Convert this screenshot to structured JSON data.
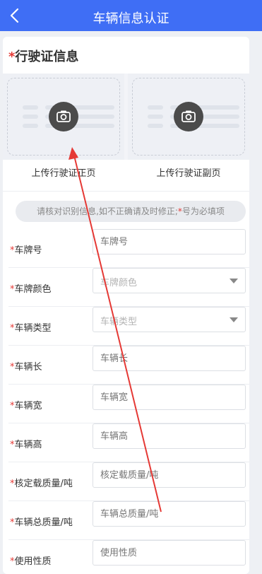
{
  "header": {
    "title": "车辆信息认证",
    "back_icon": "chevron-left-icon"
  },
  "section": {
    "title_required": "*",
    "title": "行驶证信息"
  },
  "photos": [
    {
      "caption": "上传行驶证正页",
      "icon": "camera-icon"
    },
    {
      "caption": "上传行驶证副页",
      "icon": "camera-icon"
    }
  ],
  "notice": {
    "before": "请核对识别信息,如不正确请及时修正;",
    "star": "*",
    "after": "号为必填项"
  },
  "fields": [
    {
      "label": "车牌号",
      "placeholder": "车牌号",
      "type": "input"
    },
    {
      "label": "车牌颜色",
      "placeholder": "车牌颜色",
      "type": "select"
    },
    {
      "label": "车辆类型",
      "placeholder": "车辆类型",
      "type": "select"
    },
    {
      "label": "车辆长",
      "placeholder": "车辆长",
      "type": "input"
    },
    {
      "label": "车辆宽",
      "placeholder": "车辆宽",
      "type": "input"
    },
    {
      "label": "车辆高",
      "placeholder": "车辆高",
      "type": "input"
    },
    {
      "label": "核定载质量/吨",
      "placeholder": "核定载质量/吨",
      "type": "input"
    },
    {
      "label": "车辆总质量/吨",
      "placeholder": "车辆总质量/吨",
      "type": "input"
    },
    {
      "label": "使用性质",
      "placeholder": "使用性质",
      "type": "input"
    }
  ],
  "required_mark": "*",
  "colors": {
    "header_bg": "#3f6ef5",
    "required": "#e53935",
    "annotation": "#e53935"
  }
}
